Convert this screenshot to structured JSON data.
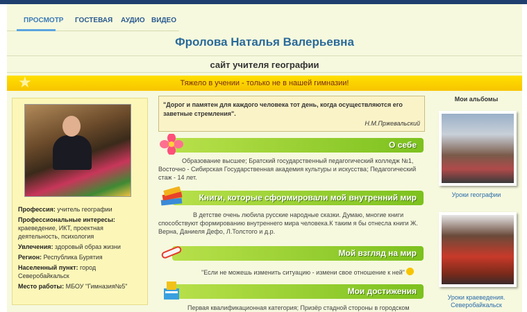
{
  "nav": {
    "items": [
      {
        "label": "ПРОСМОТР"
      },
      {
        "label": "ГОСТЕВАЯ"
      },
      {
        "label": "АУДИО"
      },
      {
        "label": "ВИДЕО"
      }
    ]
  },
  "header": {
    "title": "Фролова Наталья Валерьевна",
    "subtitle": "сайт учителя географии"
  },
  "banner": {
    "text": "Тяжело в учении - только не в нашей гимназии!"
  },
  "profile": {
    "fields": [
      {
        "key": "Профессия:",
        "value": "учитель географии"
      },
      {
        "key": "Профессиональные интересы:",
        "value": "краеведение, ИКТ, проектная деятельность, психология"
      },
      {
        "key": "Увлечения:",
        "value": "здоровый образ жизни"
      },
      {
        "key": "Регион:",
        "value": "Республика Бурятия"
      },
      {
        "key": "Населенный пункт:",
        "value": "город Северобайкальск"
      },
      {
        "key": "Место работы:",
        "value": "МБОУ \"Гимназия№5\""
      }
    ]
  },
  "quote": {
    "text": "\"Дорог и памятен для каждого человека тот день, когда осуществляются его заветные стремления\".",
    "author": "Н.М.Пржевальский"
  },
  "sections": [
    {
      "title": "О себе",
      "text": "Образование высшее; Братский государственный педагогический колледж №1, Восточно - Сибирская Государственная академия культуры и искусства; Педагогический стаж - 14 лет."
    },
    {
      "title": "Книги, которые сформировали мой внутренний мир",
      "text": "В детстве очень любила русские народные сказки. Думаю, многие книги способствуют формированию внутреннего мира человека.К таким я бы отнесла книги Ж. Верна, Даниеля Дефо,  Л.Толстого и д.р."
    },
    {
      "title": "Мой взгляд на мир",
      "text": "\"Если не можешь изменить ситуацию - измени свое отношение к ней\""
    },
    {
      "title": "Мои достижения",
      "text": "Первая квалификационная категория; Призёр стадной стороны в городском"
    }
  ],
  "albums": {
    "title": "Мои альбомы",
    "items": [
      {
        "caption": "Уроки географии"
      },
      {
        "caption": "Уроки краеведения. Северобайкальск"
      }
    ]
  },
  "colors": {
    "section_bar": "#7cc11e",
    "banner": "#f7c400",
    "title": "#2a6a9a"
  }
}
